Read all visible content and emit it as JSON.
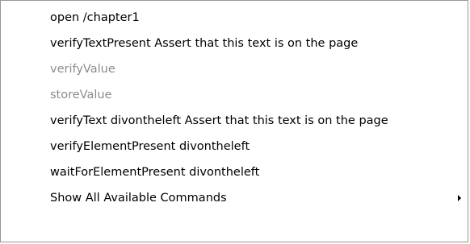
{
  "context_menu": {
    "items": [
      {
        "label": "open /chapter1",
        "enabled": true
      },
      {
        "label": "verifyTextPresent Assert that this text is on the page",
        "enabled": true
      },
      {
        "label": "verifyValue",
        "enabled": false
      },
      {
        "label": "storeValue",
        "enabled": false
      },
      {
        "label": "verifyText divontheleft Assert that this text is on the page",
        "enabled": true
      },
      {
        "label": "verifyElementPresent divontheleft",
        "enabled": true
      },
      {
        "label": "waitForElementPresent divontheleft",
        "enabled": true
      },
      {
        "label": "Show All Available Commands",
        "enabled": true,
        "has_submenu": true
      }
    ],
    "submenu_icon": "chevron-right-icon",
    "colors": {
      "text": "#000000",
      "disabled_text": "#8c8c8c",
      "border": "#979797",
      "background": "#ffffff"
    }
  }
}
